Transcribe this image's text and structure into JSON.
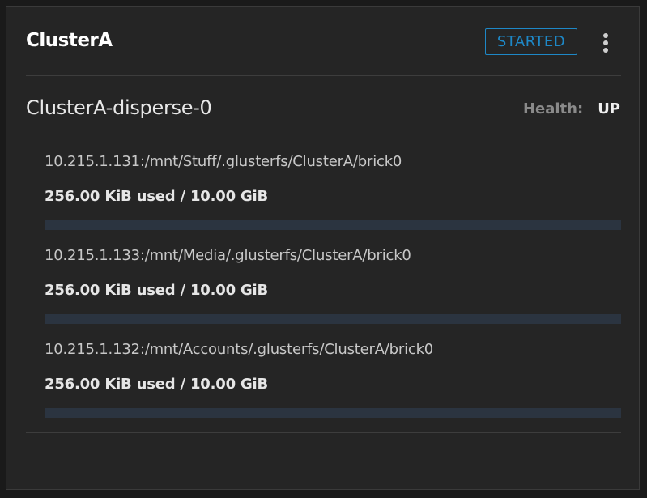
{
  "cluster": {
    "name": "ClusterA",
    "status": "STARTED",
    "menu_icon": "more-vertical-icon"
  },
  "volume": {
    "name": "ClusterA-disperse-0",
    "health_label": "Health:",
    "health_value": "UP"
  },
  "bricks": [
    {
      "path": "10.215.1.131:/mnt/Stuff/.glusterfs/ClusterA/brick0",
      "usage": "256.00 KiB used / 10.00 GiB",
      "used_fraction": 2.44e-05
    },
    {
      "path": "10.215.1.133:/mnt/Media/.glusterfs/ClusterA/brick0",
      "usage": "256.00 KiB used / 10.00 GiB",
      "used_fraction": 2.44e-05
    },
    {
      "path": "10.215.1.132:/mnt/Accounts/.glusterfs/ClusterA/brick0",
      "usage": "256.00 KiB used / 10.00 GiB",
      "used_fraction": 2.44e-05
    }
  ],
  "colors": {
    "accent": "#1e88c7",
    "progress_track": "#2b3440"
  }
}
